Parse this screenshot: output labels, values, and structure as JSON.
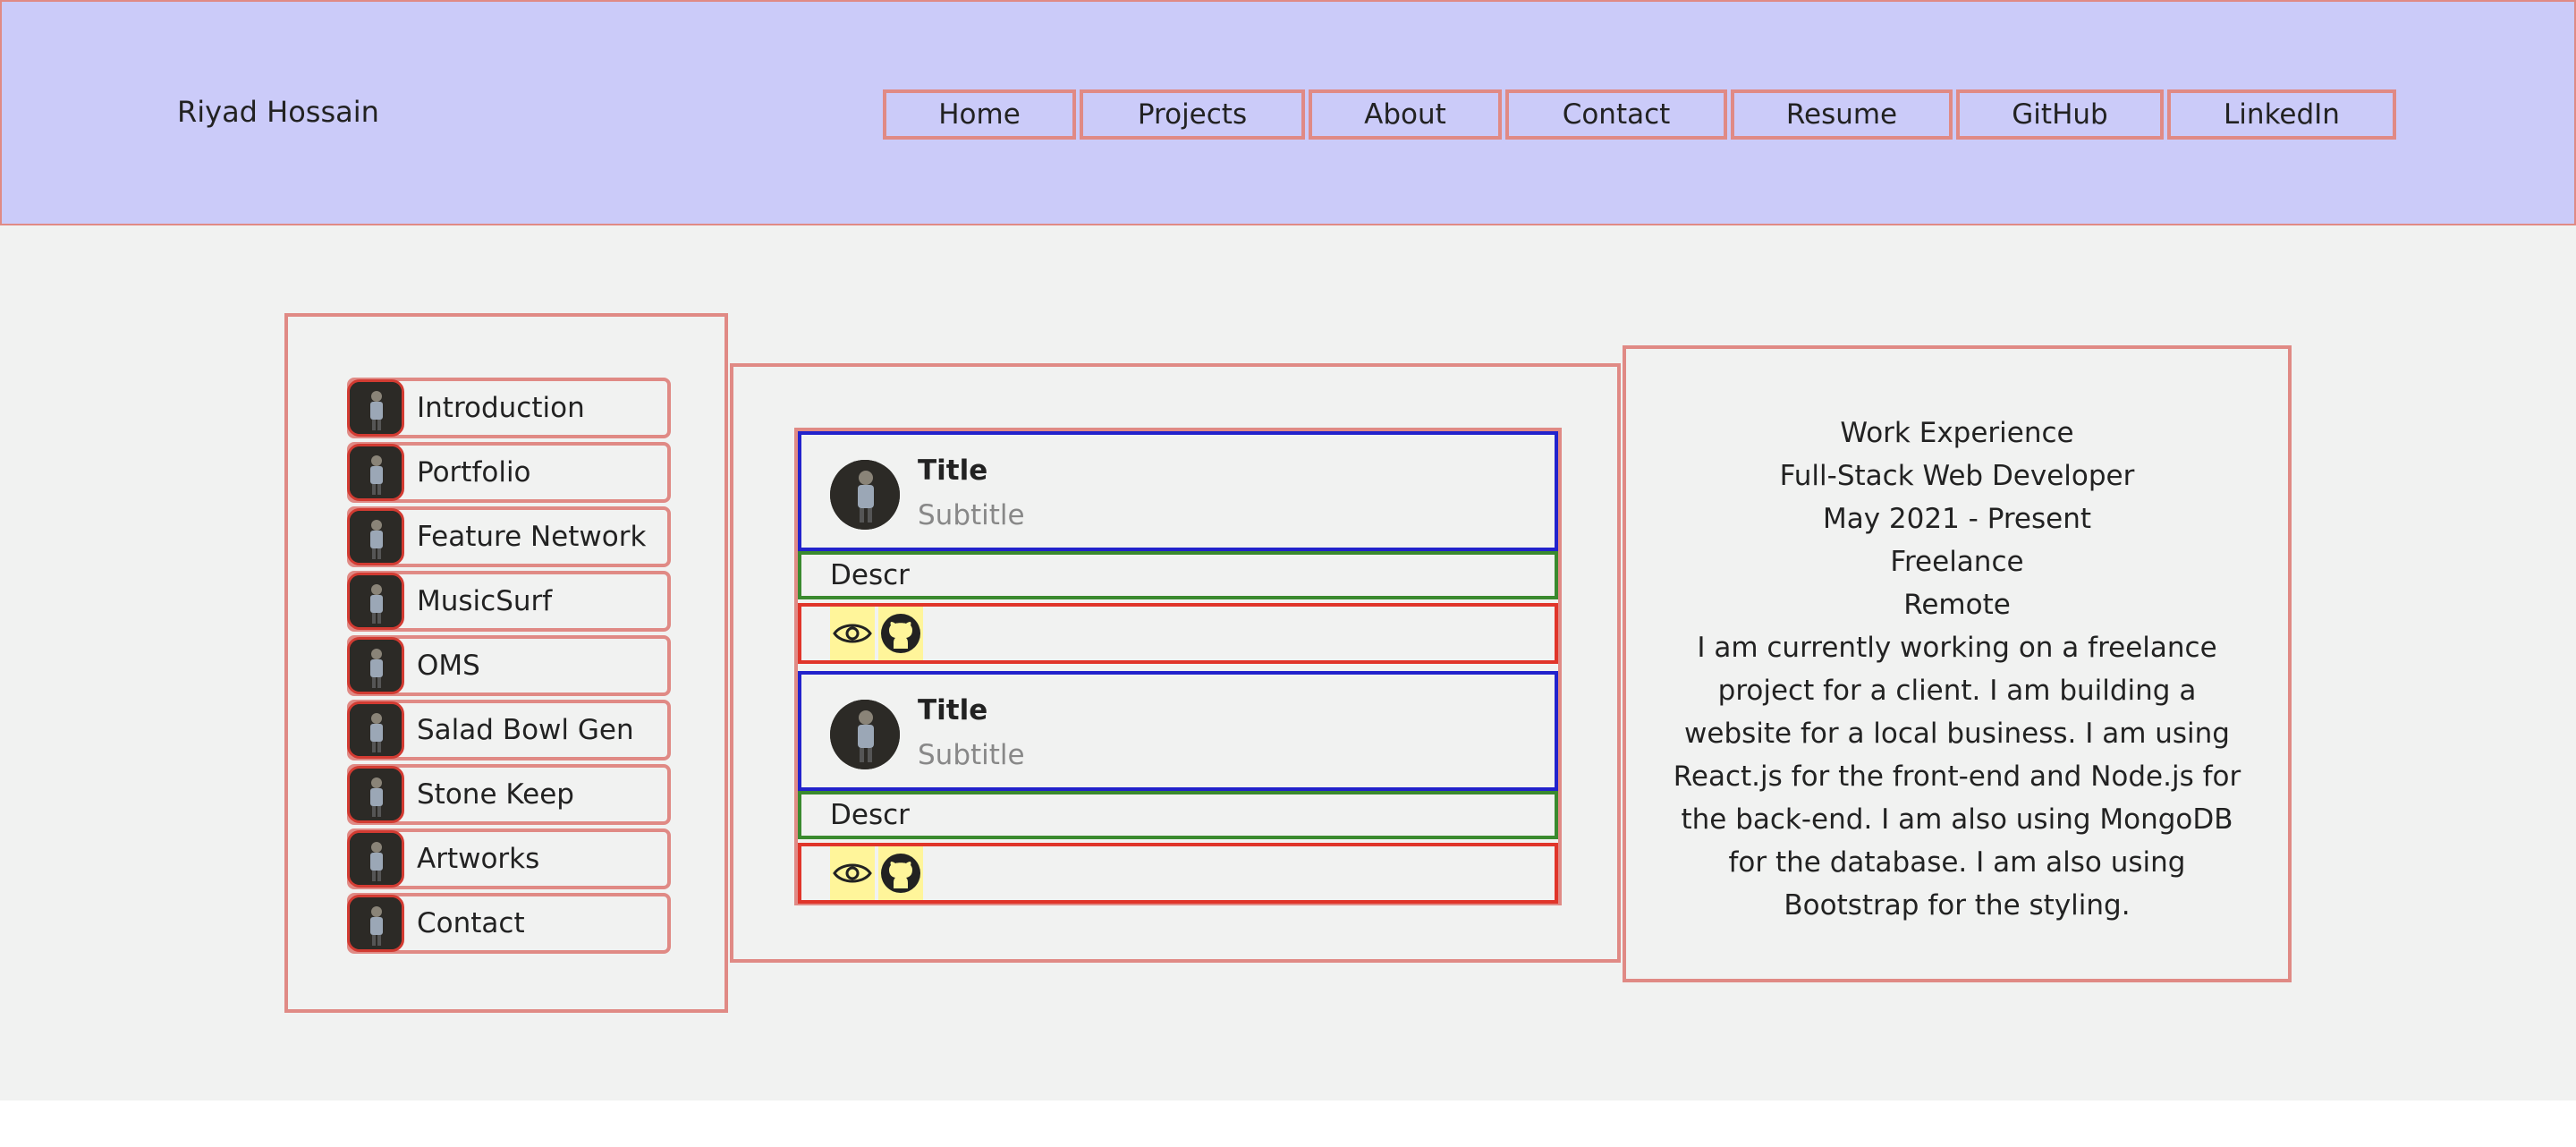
{
  "header": {
    "brand": "Riyad Hossain",
    "nav": [
      {
        "label": "Home"
      },
      {
        "label": "Projects"
      },
      {
        "label": "About"
      },
      {
        "label": "Contact"
      },
      {
        "label": "Resume"
      },
      {
        "label": "GitHub"
      },
      {
        "label": "LinkedIn"
      }
    ]
  },
  "sidebar": {
    "items": [
      {
        "label": "Introduction"
      },
      {
        "label": "Portfolio"
      },
      {
        "label": "Feature Network"
      },
      {
        "label": "MusicSurf"
      },
      {
        "label": "OMS"
      },
      {
        "label": "Salad Bowl Gen"
      },
      {
        "label": "Stone Keep"
      },
      {
        "label": "Artworks"
      },
      {
        "label": "Contact"
      }
    ]
  },
  "cards": [
    {
      "title": "Title",
      "subtitle": "Subtitle",
      "description": "Descr"
    },
    {
      "title": "Title",
      "subtitle": "Subtitle",
      "description": "Descr"
    }
  ],
  "experience": {
    "heading": "Work Experience",
    "role": "Full-Stack Web Developer",
    "dates": "May 2021 - Present",
    "type": "Freelance",
    "location": "Remote",
    "description": "I am currently working on a freelance project for a client. I am building a website for a local business. I am using React.js for the front-end and Node.js for the back-end. I am also using MongoDB for the database. I am also using Bootstrap for the styling."
  },
  "colors": {
    "header_bg": "#cbcbf9",
    "outline": "#e08a85",
    "card_head_border": "#2222cc",
    "card_desc_border": "#3a8a2e",
    "card_actions_border": "#e0352a",
    "icon_bg": "#fff59a"
  },
  "icons": {
    "view": "eye-icon",
    "repo": "github-icon"
  }
}
